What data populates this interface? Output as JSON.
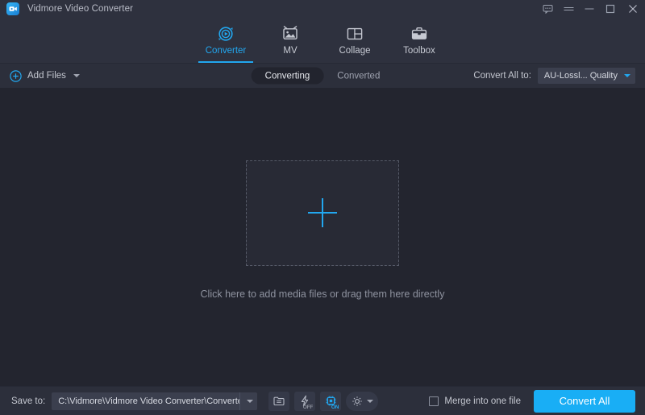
{
  "titlebar": {
    "app_title": "Vidmore Video Converter",
    "logo_icon": "video-camera-logo",
    "buttons": [
      {
        "name": "feedback-icon",
        "label": ""
      },
      {
        "name": "menu-icon",
        "label": ""
      },
      {
        "name": "minimize-icon",
        "label": ""
      },
      {
        "name": "maximize-icon",
        "label": ""
      },
      {
        "name": "close-icon",
        "label": ""
      }
    ]
  },
  "nav": {
    "tabs": [
      {
        "label": "Converter",
        "icon": "converter-icon",
        "active": true
      },
      {
        "label": "MV",
        "icon": "mv-icon",
        "active": false
      },
      {
        "label": "Collage",
        "icon": "collage-icon",
        "active": false
      },
      {
        "label": "Toolbox",
        "icon": "toolbox-icon",
        "active": false
      }
    ]
  },
  "toolbar": {
    "add_files_label": "Add Files",
    "add_files_icon": "plus-circle-icon",
    "add_files_caret": "chevron-down-icon",
    "segments": [
      {
        "label": "Converting",
        "active": true
      },
      {
        "label": "Converted",
        "active": false
      }
    ],
    "convert_all_to_label": "Convert All to:",
    "convert_all_to_value": "AU-Lossl... Quality"
  },
  "content": {
    "dropzone_icon": "plus-icon",
    "hint": "Click here to add media files or drag them here directly"
  },
  "bottombar": {
    "save_to_label": "Save to:",
    "save_to_path": "C:\\Vidmore\\Vidmore Video Converter\\Converted",
    "tools": [
      {
        "name": "open-folder-icon",
        "state": ""
      },
      {
        "name": "lightning-icon",
        "state": "OFF"
      },
      {
        "name": "gpu-chip-icon",
        "state": "ON"
      },
      {
        "name": "settings-gear-icon",
        "state": ""
      }
    ],
    "merge_label": "Merge into one file",
    "merge_checked": false,
    "convert_all_label": "Convert All"
  },
  "colors": {
    "accent": "#19aef5",
    "titlebar_bg": "#2e313e",
    "content_bg": "#23252f",
    "bar_bg": "#2c2f3b",
    "field_bg": "#3b3f4e"
  }
}
